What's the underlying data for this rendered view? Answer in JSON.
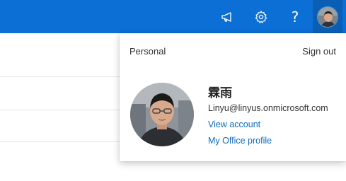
{
  "header": {
    "background": "#0b6fd5",
    "icons": {
      "feedback": "megaphone-icon",
      "settings": "gear-icon",
      "help": "question-mark-icon",
      "help_glyph": "?"
    }
  },
  "account_panel": {
    "tenant_label": "Personal",
    "sign_out_label": "Sign out",
    "display_name": "霖雨",
    "email": "Linyu@linyus.onmicrosoft.com",
    "view_account_label": "View account",
    "office_profile_label": "My Office profile",
    "link_color": "#0f6cbd"
  }
}
